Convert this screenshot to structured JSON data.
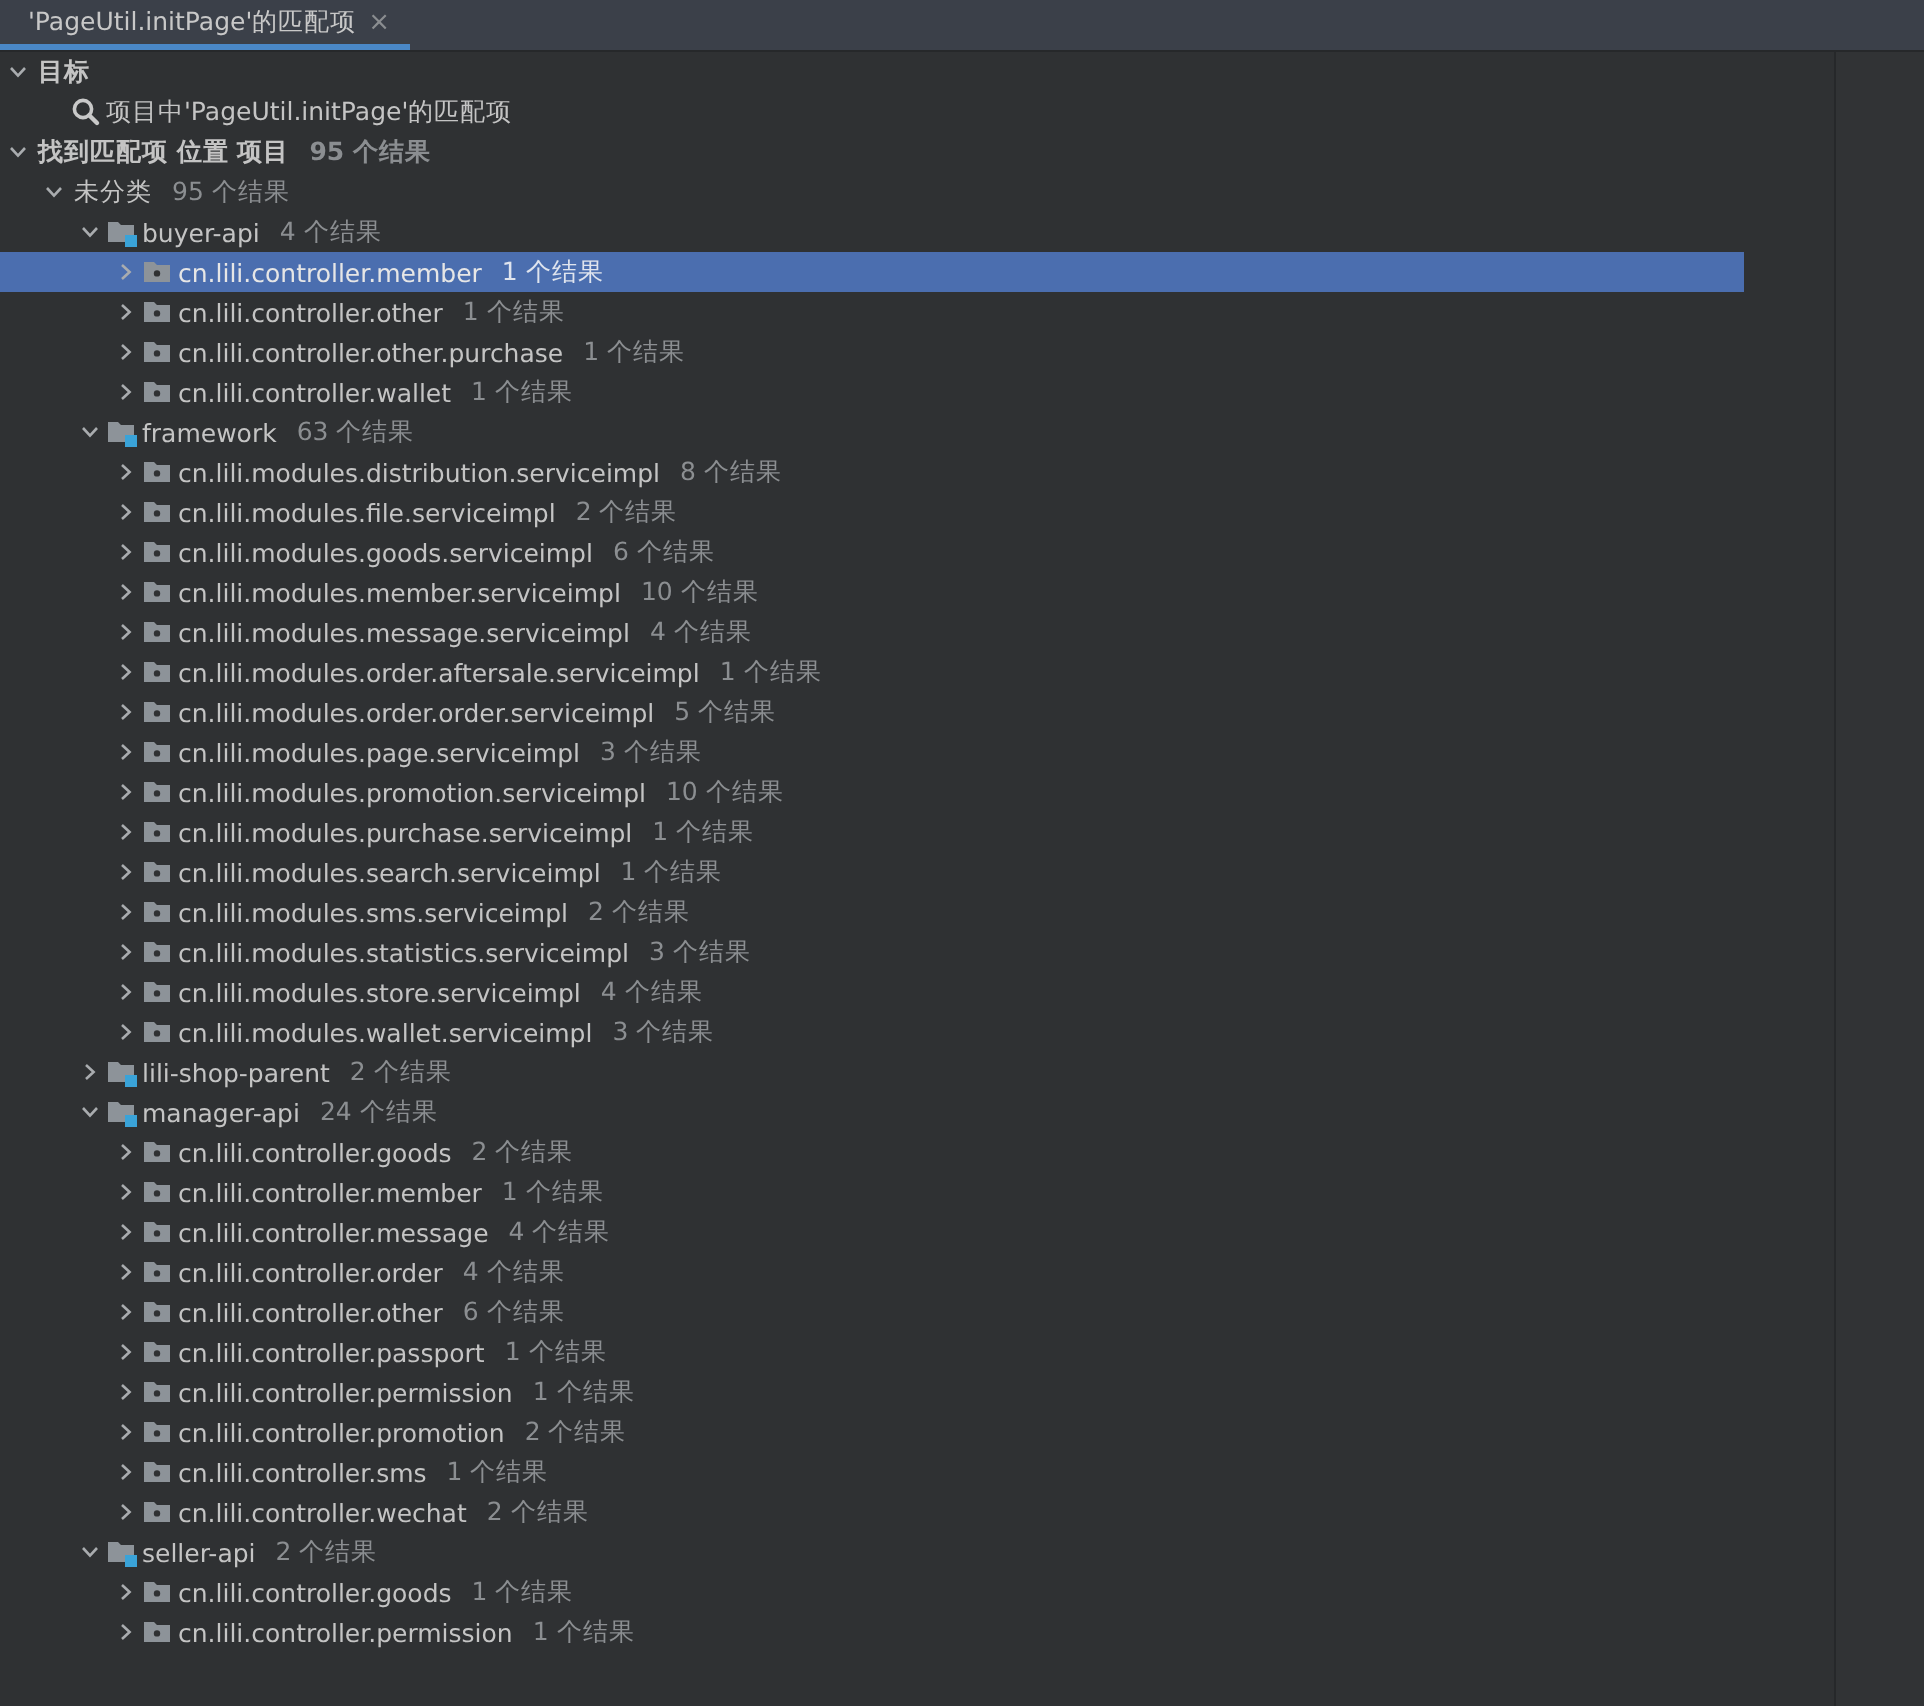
{
  "tab": {
    "label": "'PageUtil.initPage'的匹配项",
    "selected": true,
    "close": "×"
  },
  "tree": [
    {
      "kind": "group",
      "label": "目标",
      "expanded": true,
      "children": [
        {
          "kind": "search",
          "label": "项目中'PageUtil.initPage'的匹配项"
        }
      ]
    },
    {
      "kind": "group",
      "label": "找到匹配项 位置 项目",
      "count": "95 个结果",
      "expanded": true,
      "children": [
        {
          "kind": "category",
          "label": "未分类",
          "count": "95 个结果",
          "expanded": true,
          "children": [
            {
              "kind": "module",
              "label": "buyer-api",
              "count": "4 个结果",
              "expanded": true,
              "children": [
                {
                  "kind": "package",
                  "label": "cn.lili.controller.member",
                  "count": "1 个结果",
                  "expanded": false,
                  "selected": true
                },
                {
                  "kind": "package",
                  "label": "cn.lili.controller.other",
                  "count": "1 个结果",
                  "expanded": false,
                  "selected": false
                },
                {
                  "kind": "package",
                  "label": "cn.lili.controller.other.purchase",
                  "count": "1 个结果",
                  "expanded": false,
                  "selected": false
                },
                {
                  "kind": "package",
                  "label": "cn.lili.controller.wallet",
                  "count": "1 个结果",
                  "expanded": false,
                  "selected": false
                }
              ]
            },
            {
              "kind": "module",
              "label": "framework",
              "count": "63 个结果",
              "expanded": true,
              "children": [
                {
                  "kind": "package",
                  "label": "cn.lili.modules.distribution.serviceimpl",
                  "count": "8 个结果",
                  "expanded": false,
                  "selected": false
                },
                {
                  "kind": "package",
                  "label": "cn.lili.modules.file.serviceimpl",
                  "count": "2 个结果",
                  "expanded": false,
                  "selected": false
                },
                {
                  "kind": "package",
                  "label": "cn.lili.modules.goods.serviceimpl",
                  "count": "6 个结果",
                  "expanded": false,
                  "selected": false
                },
                {
                  "kind": "package",
                  "label": "cn.lili.modules.member.serviceimpl",
                  "count": "10 个结果",
                  "expanded": false,
                  "selected": false
                },
                {
                  "kind": "package",
                  "label": "cn.lili.modules.message.serviceimpl",
                  "count": "4 个结果",
                  "expanded": false,
                  "selected": false
                },
                {
                  "kind": "package",
                  "label": "cn.lili.modules.order.aftersale.serviceimpl",
                  "count": "1 个结果",
                  "expanded": false,
                  "selected": false
                },
                {
                  "kind": "package",
                  "label": "cn.lili.modules.order.order.serviceimpl",
                  "count": "5 个结果",
                  "expanded": false,
                  "selected": false
                },
                {
                  "kind": "package",
                  "label": "cn.lili.modules.page.serviceimpl",
                  "count": "3 个结果",
                  "expanded": false,
                  "selected": false
                },
                {
                  "kind": "package",
                  "label": "cn.lili.modules.promotion.serviceimpl",
                  "count": "10 个结果",
                  "expanded": false,
                  "selected": false
                },
                {
                  "kind": "package",
                  "label": "cn.lili.modules.purchase.serviceimpl",
                  "count": "1 个结果",
                  "expanded": false,
                  "selected": false
                },
                {
                  "kind": "package",
                  "label": "cn.lili.modules.search.serviceimpl",
                  "count": "1 个结果",
                  "expanded": false,
                  "selected": false
                },
                {
                  "kind": "package",
                  "label": "cn.lili.modules.sms.serviceimpl",
                  "count": "2 个结果",
                  "expanded": false,
                  "selected": false
                },
                {
                  "kind": "package",
                  "label": "cn.lili.modules.statistics.serviceimpl",
                  "count": "3 个结果",
                  "expanded": false,
                  "selected": false
                },
                {
                  "kind": "package",
                  "label": "cn.lili.modules.store.serviceimpl",
                  "count": "4 个结果",
                  "expanded": false,
                  "selected": false
                },
                {
                  "kind": "package",
                  "label": "cn.lili.modules.wallet.serviceimpl",
                  "count": "3 个结果",
                  "expanded": false,
                  "selected": false
                }
              ]
            },
            {
              "kind": "module",
              "label": "lili-shop-parent",
              "count": "2 个结果",
              "expanded": false
            },
            {
              "kind": "module",
              "label": "manager-api",
              "count": "24 个结果",
              "expanded": true,
              "children": [
                {
                  "kind": "package",
                  "label": "cn.lili.controller.goods",
                  "count": "2 个结果",
                  "expanded": false,
                  "selected": false
                },
                {
                  "kind": "package",
                  "label": "cn.lili.controller.member",
                  "count": "1 个结果",
                  "expanded": false,
                  "selected": false
                },
                {
                  "kind": "package",
                  "label": "cn.lili.controller.message",
                  "count": "4 个结果",
                  "expanded": false,
                  "selected": false
                },
                {
                  "kind": "package",
                  "label": "cn.lili.controller.order",
                  "count": "4 个结果",
                  "expanded": false,
                  "selected": false
                },
                {
                  "kind": "package",
                  "label": "cn.lili.controller.other",
                  "count": "6 个结果",
                  "expanded": false,
                  "selected": false
                },
                {
                  "kind": "package",
                  "label": "cn.lili.controller.passport",
                  "count": "1 个结果",
                  "expanded": false,
                  "selected": false
                },
                {
                  "kind": "package",
                  "label": "cn.lili.controller.permission",
                  "count": "1 个结果",
                  "expanded": false,
                  "selected": false
                },
                {
                  "kind": "package",
                  "label": "cn.lili.controller.promotion",
                  "count": "2 个结果",
                  "expanded": false,
                  "selected": false
                },
                {
                  "kind": "package",
                  "label": "cn.lili.controller.sms",
                  "count": "1 个结果",
                  "expanded": false,
                  "selected": false
                },
                {
                  "kind": "package",
                  "label": "cn.lili.controller.wechat",
                  "count": "2 个结果",
                  "expanded": false,
                  "selected": false
                }
              ]
            },
            {
              "kind": "module",
              "label": "seller-api",
              "count": "2 个结果",
              "expanded": true,
              "children": [
                {
                  "kind": "package",
                  "label": "cn.lili.controller.goods",
                  "count": "1 个结果",
                  "expanded": false,
                  "selected": false
                },
                {
                  "kind": "package",
                  "label": "cn.lili.controller.permission",
                  "count": "1 个结果",
                  "expanded": false,
                  "selected": false
                }
              ]
            }
          ]
        }
      ]
    }
  ]
}
